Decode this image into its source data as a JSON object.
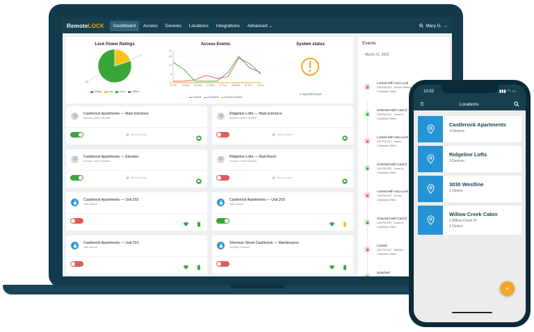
{
  "nav": {
    "logo_prefix": "Remote",
    "logo_suffix": "LOCK",
    "items": [
      "Dashboard",
      "Access",
      "Devices",
      "Locations",
      "Integrations",
      "Advanced"
    ],
    "user": "Mary G."
  },
  "power": {
    "title": "Lock Power Ratings",
    "legend": [
      {
        "label": "Critical",
        "color": "#d9534f"
      },
      {
        "label": "Low",
        "color": "#f5c518"
      },
      {
        "label": "Good",
        "color": "#3aa63a"
      },
      {
        "label": "Offline",
        "color": "#777777"
      }
    ],
    "slice_labels": [
      "2",
      "32"
    ]
  },
  "access": {
    "title": "Access Events",
    "legend": [
      "Locked",
      "Unlocked",
      "Access Denied"
    ]
  },
  "status": {
    "title": "System status",
    "link": "1 reported issue"
  },
  "chart_data": [
    {
      "type": "pie",
      "title": "Lock Power Ratings",
      "categories": [
        "Critical",
        "Low",
        "Good",
        "Offline"
      ],
      "values": [
        0,
        8,
        32,
        0
      ],
      "colors": [
        "#d9534f",
        "#f5c518",
        "#3aa63a",
        "#777777"
      ]
    },
    {
      "type": "line",
      "title": "Access Events",
      "categories": [
        "19 Fri",
        "19 Sat",
        "20 Sun",
        "21 Mon",
        "22 Tue",
        "23 Wed",
        "24 Thu",
        "25 Fri"
      ],
      "yticks": [
        "0",
        "6",
        "12",
        "18",
        "22"
      ],
      "ylim": [
        0,
        22
      ],
      "series": [
        {
          "name": "Locked",
          "color": "#d9534f",
          "values": [
            1,
            1,
            2,
            5,
            3,
            4,
            17,
            13,
            6
          ]
        },
        {
          "name": "Unlocked",
          "color": "#3aa63a",
          "values": [
            14,
            9,
            1,
            1,
            1,
            7,
            18,
            10,
            7
          ]
        },
        {
          "name": "Access Denied",
          "color": "#f5a623",
          "values": [
            0,
            0,
            0,
            0,
            0,
            0,
            0,
            0,
            0
          ]
        }
      ]
    }
  ],
  "cards": [
    {
      "title": "Castlerock Apartments — Main Entrance",
      "sub": "Access Control System",
      "kind": "acs",
      "toggle": "green",
      "temp": "Temp Unlock",
      "status": "cloud"
    },
    {
      "title": "Ridgeline Lofts — Main Entrance",
      "sub": "Access Control System",
      "kind": "acs",
      "toggle": "red",
      "temp": "Temp Unlock",
      "status": "cloud"
    },
    {
      "title": "Castlerock Apartments — Elevator",
      "sub": "Access Control System",
      "kind": "acs",
      "toggle": "green",
      "temp": "Temp Unlock",
      "status": "cloud"
    },
    {
      "title": "Ridgeline Lofts — Mail Room",
      "sub": "Access Control System",
      "kind": "acs",
      "toggle": "red",
      "temp": "Temp Unlock",
      "status": "cloud"
    },
    {
      "title": "Castlerock Apartments — Unit 202",
      "sub": "Yale Assure",
      "kind": "lock",
      "toggle": "red",
      "battery": "green"
    },
    {
      "title": "Castlerock Apartments — Unit 203",
      "sub": "Yale Assure",
      "kind": "lock",
      "toggle": "green",
      "battery": "yellow"
    },
    {
      "title": "Castlerock Apartments — Unit 201",
      "sub": "Yale Assure",
      "kind": "lock",
      "toggle": "red",
      "battery": "green"
    },
    {
      "title": "Sherman Street Castlerock — Maintenance",
      "sub": "Schlage Connect",
      "kind": "lock",
      "toggle": "red",
      "battery": "green"
    }
  ],
  "events": {
    "title": "Events",
    "date": "March 21, 2022",
    "items": [
      {
        "title": "Locked with Auto-Lock",
        "time": "3:53 PM EDT · Device Parking Garage ·",
        "loc": "Charleston Office",
        "kind": "locked"
      },
      {
        "title": "Unlocked with Card D",
        "time": "3:53 PM EDT · Learn-m",
        "loc": "Charleston Office",
        "kind": "unlocked"
      },
      {
        "title": "Locked with Auto-Lock",
        "time": "3:53 PM EDT · Device",
        "loc": "Charleston Office",
        "kind": "locked"
      },
      {
        "title": "Unlocked with Card D",
        "time": "3:53 PM EDT · Learn-m",
        "loc": "Charleston Office",
        "kind": "unlocked"
      },
      {
        "title": "Locked with Auto-Lock",
        "time": "3:53 PM EDT · Device",
        "loc": "Charleston Office",
        "kind": "locked"
      },
      {
        "title": "Unlocked with Card D",
        "time": "3:53 PM EDT · Learn-m",
        "loc": "Charleston Office",
        "kind": "unlocked"
      },
      {
        "title": "Locked",
        "time": "3:51 PM EDT · Network",
        "loc": "Charleston Office",
        "kind": "locked"
      },
      {
        "title": "Unlocked",
        "time": "3:53 PM EDT ·",
        "loc": "",
        "kind": "unlocked"
      }
    ]
  },
  "phone": {
    "time": "10:52",
    "title": "Locations",
    "locations": [
      {
        "title": "Castlerock Apartments",
        "sub": "3 Devices",
        "sub2": ""
      },
      {
        "title": "Ridgeline Lofts",
        "sub": "3 Devices",
        "sub2": ""
      },
      {
        "title": "3030 Westline",
        "sub": "1 Device",
        "sub2": ""
      },
      {
        "title": "Willow Creek Cabin",
        "sub": "1 Willow Creek Dr",
        "sub2": "1 Device"
      }
    ],
    "fab": "+"
  },
  "colors": {
    "navy": "#163f4f",
    "green": "#3aa63a",
    "red": "#e05a5a",
    "blue": "#2693d6",
    "orange": "#f5a623"
  }
}
